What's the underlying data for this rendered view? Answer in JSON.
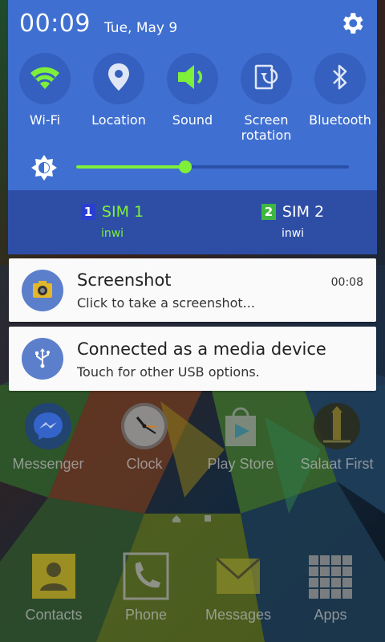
{
  "status": {
    "time": "00:09",
    "date": "Tue, May 9"
  },
  "toggles": [
    {
      "label": "Wi-Fi",
      "icon": "wifi-icon",
      "active": true
    },
    {
      "label": "Location",
      "icon": "location-icon",
      "active": false
    },
    {
      "label": "Sound",
      "icon": "sound-icon",
      "active": true
    },
    {
      "label": "Screen\nrotation",
      "label1": "Screen",
      "label2": "rotation",
      "icon": "screen-rotation-icon",
      "active": false
    },
    {
      "label": "Bluetooth",
      "icon": "bluetooth-icon",
      "active": false
    }
  ],
  "brightness": {
    "level": 0.4
  },
  "sims": [
    {
      "num": "1",
      "name": "SIM 1",
      "carrier": "inwi",
      "color": "#7ef03a",
      "badge": "#2a3fcf"
    },
    {
      "num": "2",
      "name": "SIM 2",
      "carrier": "inwi",
      "color": "#ffffff",
      "badge": "#3fb83f"
    }
  ],
  "notifications": [
    {
      "title": "Screenshot",
      "subtitle": "Click to take a screenshot...",
      "time": "00:08",
      "icon": "screenshot-icon"
    },
    {
      "title": "Connected as a media device",
      "subtitle": "Touch for other USB options.",
      "icon": "usb-icon"
    }
  ],
  "apps": {
    "row1": [
      {
        "label": "Messenger",
        "icon": "messenger-icon"
      },
      {
        "label": "Clock",
        "icon": "clock-icon"
      },
      {
        "label": "Play Store",
        "icon": "play-store-icon"
      },
      {
        "label": "Salaat First",
        "icon": "salaat-first-icon"
      }
    ],
    "dock": [
      {
        "label": "Contacts",
        "icon": "contacts-icon"
      },
      {
        "label": "Phone",
        "icon": "phone-icon"
      },
      {
        "label": "Messages",
        "icon": "messages-icon"
      },
      {
        "label": "Apps",
        "icon": "apps-icon"
      }
    ]
  },
  "colors": {
    "panel": "#3f6fd0",
    "accent": "#7ef03a",
    "sim_bar": "#2e4ea6"
  }
}
